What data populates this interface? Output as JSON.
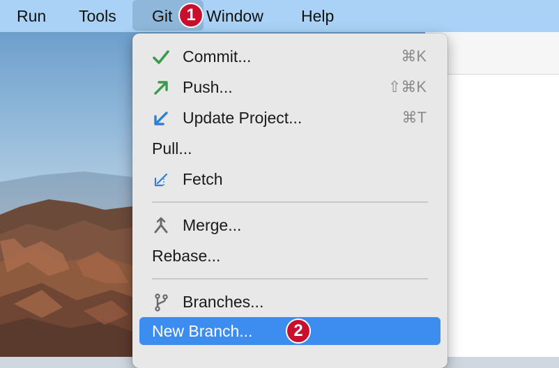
{
  "menubar": {
    "items": [
      "Run",
      "Tools",
      "Git",
      "Window",
      "Help"
    ],
    "active": "Git"
  },
  "badges": [
    "1",
    "2"
  ],
  "git_menu": {
    "items": [
      {
        "label": "Commit...",
        "icon": "check-icon",
        "shortcut": "⌘K"
      },
      {
        "label": "Push...",
        "icon": "push-arrow-icon",
        "shortcut": "⇧⌘K"
      },
      {
        "label": "Update Project...",
        "icon": "update-arrow-icon",
        "shortcut": "⌘T"
      },
      {
        "label": "Pull...",
        "icon": null,
        "shortcut": ""
      },
      {
        "label": "Fetch",
        "icon": "fetch-icon",
        "shortcut": ""
      },
      {
        "label": "Merge...",
        "icon": "merge-icon",
        "shortcut": ""
      },
      {
        "label": "Rebase...",
        "icon": null,
        "shortcut": ""
      },
      {
        "label": "Branches...",
        "icon": "branch-icon",
        "shortcut": ""
      },
      {
        "label": "New Branch...",
        "icon": null,
        "shortcut": "",
        "selected": true
      }
    ]
  },
  "colors": {
    "menubar_bg": "#a9d2f6",
    "selection": "#3d8cf0",
    "badge": "#c8102e",
    "check_green": "#3a9a4a",
    "update_blue": "#2f7fd1"
  }
}
